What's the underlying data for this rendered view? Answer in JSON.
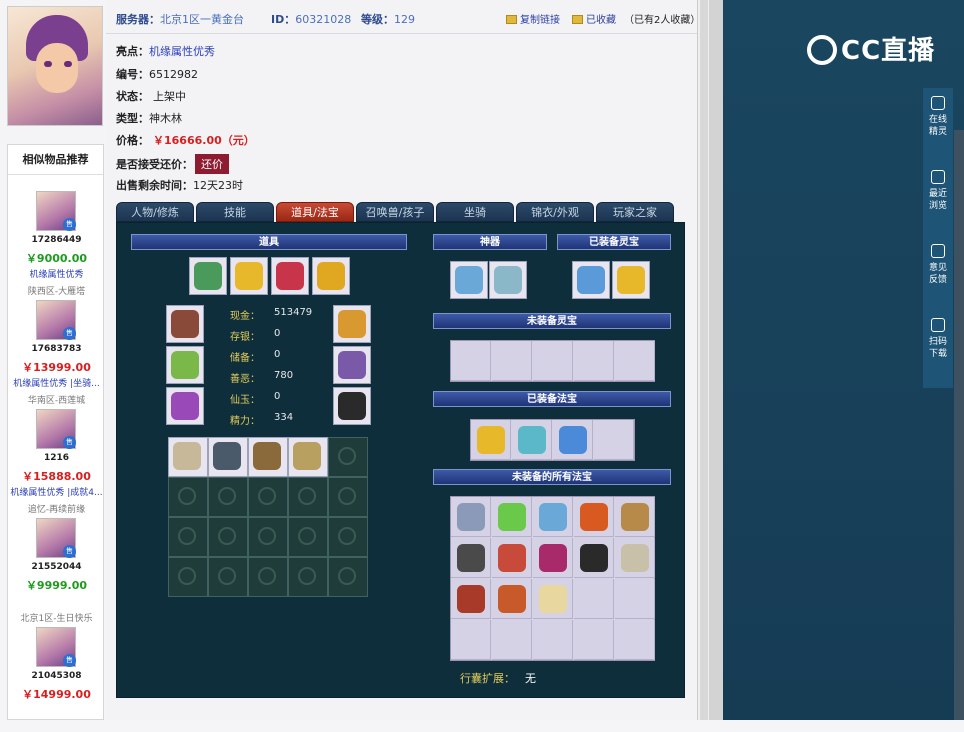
{
  "header": {
    "server_label": "服务器：",
    "server_value": "北京1区一黄金台",
    "id_label": "ID：",
    "id_value": "60321028",
    "level_label": "等级：",
    "level_value": "129",
    "copy_link": "复制链接",
    "favorited": "已收藏",
    "fav_count": "（已有2人收藏）"
  },
  "info": {
    "highlight_label": "亮点：",
    "highlight_value": "机缘属性优秀",
    "number_label": "编号：",
    "number_value": "6512982",
    "status_label": "状态：",
    "status_value": "上架中",
    "type_label": "类型：",
    "type_value": "神木林",
    "price_label": "价格：",
    "price_value": "￥16666.00（元）",
    "bargain_label": "是否接受还价：",
    "bargain_button": "还价",
    "remaining_label": "出售剩余时间：",
    "remaining_value": "12天23时"
  },
  "tabs": [
    "人物/修炼",
    "技能",
    "道具/法宝",
    "召唤兽/孩子",
    "坐骑",
    "锦衣/外观",
    "玩家之家"
  ],
  "panel": {
    "props_title": "道具",
    "artifact_title": "神器",
    "equipped_spirit_title": "已装备灵宝",
    "unequipped_spirit_title": "未装备灵宝",
    "equipped_treasure_title": "已装备法宝",
    "unequipped_treasure_title": "未装备的所有法宝",
    "bag_expand_label": "行囊扩展：",
    "bag_expand_value": "无"
  },
  "stats": [
    {
      "k": "现金：",
      "v": "513479"
    },
    {
      "k": "存银：",
      "v": "0"
    },
    {
      "k": "储备：",
      "v": "0"
    },
    {
      "k": "善恶：",
      "v": "780"
    },
    {
      "k": "仙玉：",
      "v": "0"
    },
    {
      "k": "精力：",
      "v": "334"
    }
  ],
  "similar": {
    "title": "相似物品推荐",
    "items": [
      {
        "id": "17286449",
        "price": "￥9000.00",
        "desc": "机缘属性优秀",
        "server": "陕西区-大雁塔",
        "price_color": "#1c9b1c"
      },
      {
        "id": "17683783",
        "price": "￥13999.00",
        "desc": "机缘属性优秀 |坐骑...",
        "server": "华南区-西莲城",
        "price_color": "#d81e1e"
      },
      {
        "id": "1216",
        "price": "￥15888.00",
        "desc": "机缘属性优秀 |成就4...",
        "server": "追忆-再续前缘",
        "price_color": "#d81e1e"
      },
      {
        "id": "21552044",
        "price": "￥9999.00",
        "desc": "",
        "server": "北京1区-生日快乐",
        "price_color": "#1c9b1c"
      },
      {
        "id": "21045308",
        "price": "￥14999.00",
        "desc": "",
        "server": "",
        "price_color": "#d81e1e"
      }
    ],
    "badge": "售"
  },
  "brand": {
    "logo": "CC直播"
  },
  "rail": [
    {
      "label": "在线\n精灵"
    },
    {
      "label": "最近\n浏览"
    },
    {
      "label": "意见\n反馈"
    },
    {
      "label": "扫码\n下载"
    }
  ],
  "colors": {
    "accent": "#2d4b8e",
    "price": "#d81e1e",
    "panel": "#0e2e3c",
    "bar": "#1f3476",
    "active_tab": "#c84a36"
  }
}
